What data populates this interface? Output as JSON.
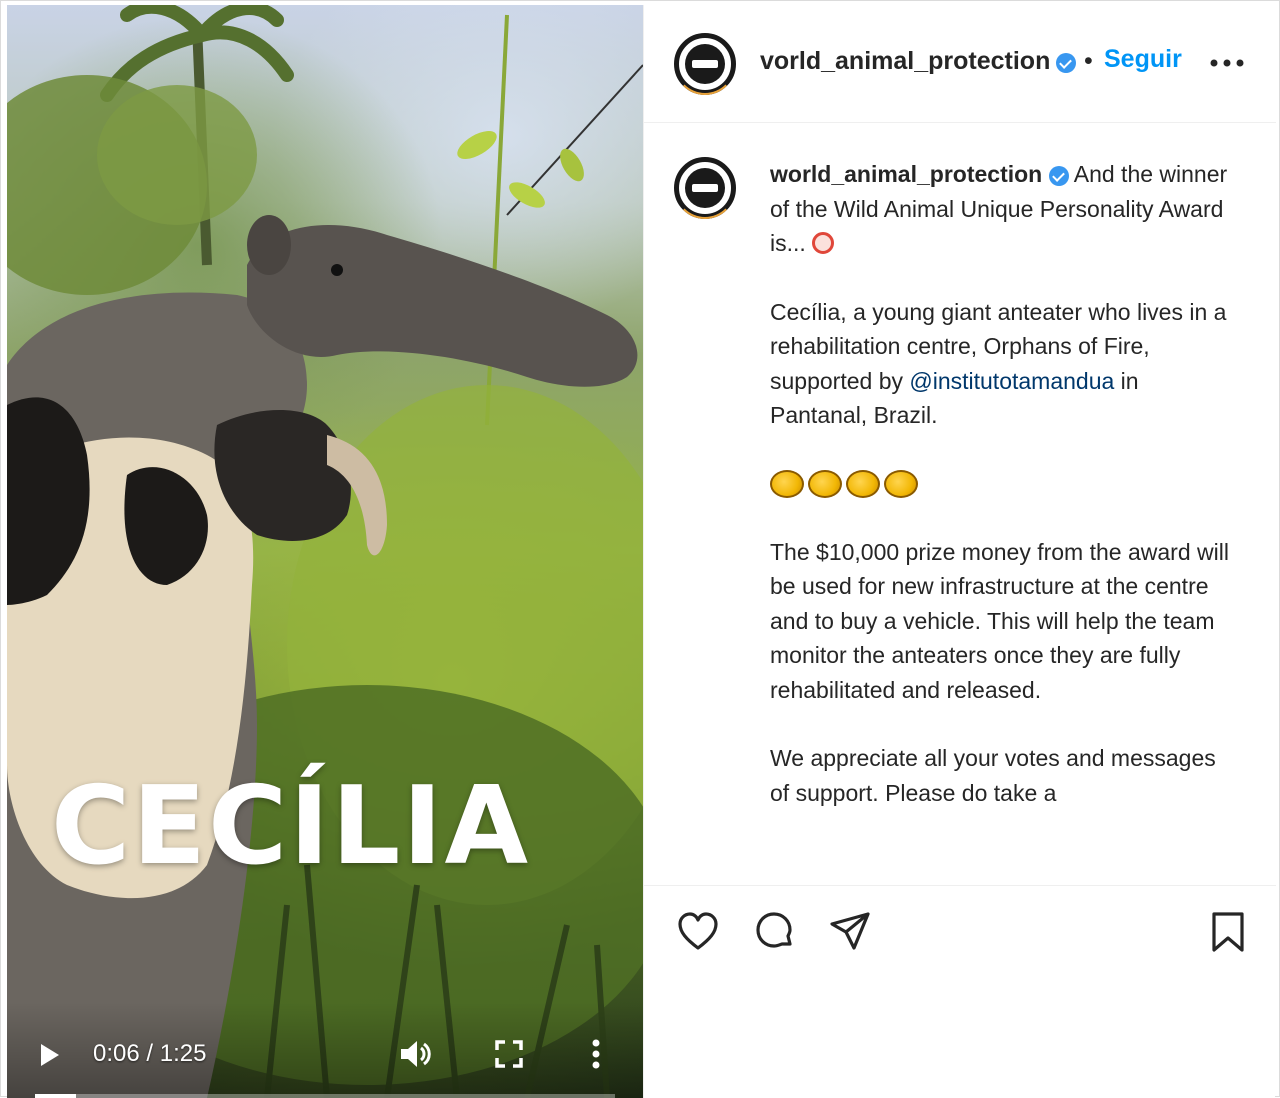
{
  "post": {
    "overlay_title": "CECÍLIA",
    "video": {
      "time": "0:06 / 1:25",
      "progress": 0.07
    }
  },
  "header": {
    "username": "vorld_animal_protection",
    "separator": "•",
    "follow_label": "Seguir"
  },
  "caption": {
    "username": "world_animal_protection",
    "intro": "And the winner of the Wild Animal Unique Personality Award is...",
    "para1_before": "Cecília, a young giant anteater who lives in a rehabilitation centre, Orphans of Fire, supported by ",
    "mention": "@institutotamandua",
    "para1_after": " in Pantanal, Brazil.",
    "para2": "The $10,000 prize money from the award will be used for new infrastructure at the centre and to buy a vehicle. This will help the team monitor the anteaters once they are fully rehabilitated and released.",
    "para3": "We appreciate all your votes and messages of support. Please do take a"
  },
  "icons": {
    "verified": "verified-badge-icon",
    "options": "more-options-icon",
    "clock": "alarm-clock-emoji",
    "clap": "clapping-hands-emoji",
    "like": "heart-icon",
    "comment": "comment-icon",
    "share": "paper-plane-icon",
    "save": "bookmark-icon",
    "play": "play-icon",
    "volume": "volume-icon",
    "fullscreen": "fullscreen-icon",
    "more_vertical": "vertical-dots-icon"
  },
  "colors": {
    "link": "#0095f6",
    "text": "#262626",
    "verified": "#3897f0",
    "mention": "#00376b"
  }
}
